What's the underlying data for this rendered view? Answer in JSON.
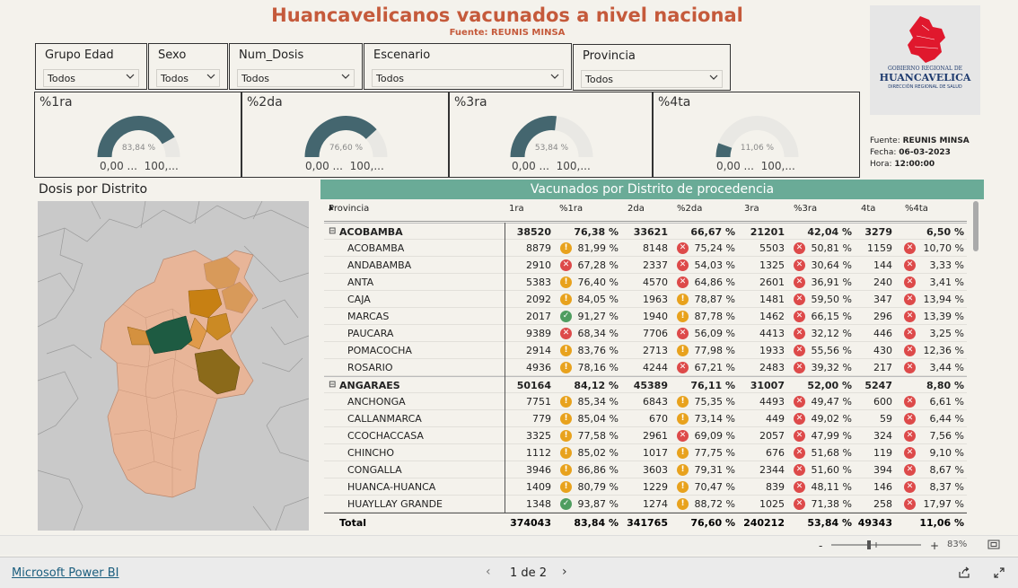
{
  "header": {
    "title": "Huancavelicanos vacunados a nivel nacional",
    "subtitle": "Fuente: REUNIS MINSA"
  },
  "logo": {
    "line1": "GOBIERNO REGIONAL DE",
    "line2": "HUANCAVELICA",
    "line3": "DIRECCIÓN REGIONAL DE SALUD"
  },
  "meta": {
    "fuente_label": "Fuente:",
    "fuente": "REUNIS MINSA",
    "fecha_label": "Fecha:",
    "fecha": "06-03-2023",
    "hora_label": "Hora:",
    "hora": "12:00:00"
  },
  "slicers": [
    {
      "label": "Grupo Edad",
      "value": "Todos"
    },
    {
      "label": "Sexo",
      "value": "Todos"
    },
    {
      "label": "Num_Dosis",
      "value": "Todos"
    },
    {
      "label": "Escenario",
      "value": "Todos"
    },
    {
      "label": "Provincia",
      "value": "Todos"
    }
  ],
  "kpis": [
    {
      "label": "%1ra",
      "value_text": "83,84 %",
      "fraction": 0.8384,
      "min": "0,00 ...",
      "max": "100,..."
    },
    {
      "label": "%2da",
      "value_text": "76,60 %",
      "fraction": 0.766,
      "min": "0,00 ...",
      "max": "100,..."
    },
    {
      "label": "%3ra",
      "value_text": "53,84 %",
      "fraction": 0.5384,
      "min": "0,00 ...",
      "max": "100,..."
    },
    {
      "label": "%4ta",
      "value_text": "11,06 %",
      "fraction": 0.1106,
      "min": "0,00 ...",
      "max": "100,..."
    }
  ],
  "map": {
    "title": "Dosis por Distrito"
  },
  "table": {
    "title": "Vacunados por Distrito de procedencia",
    "columns": [
      "Provincia",
      "1ra",
      "%1ra",
      "2da",
      "%2da",
      "3ra",
      "%3ra",
      "4ta",
      "%4ta"
    ],
    "rows": [
      {
        "type": "prov",
        "name": "ACOBAMBA",
        "d1": "38520",
        "p1": "76,38 %",
        "d2": "33621",
        "p2": "66,67 %",
        "d3": "21201",
        "p3": "42,04 %",
        "d4": "3279",
        "p4": "6,50 %"
      },
      {
        "type": "dist",
        "name": "ACOBAMBA",
        "d1": "8879",
        "p1": "81,99 %",
        "i1": "yel",
        "d2": "8148",
        "p2": "75,24 %",
        "i2": "red",
        "d3": "5503",
        "p3": "50,81 %",
        "i3": "red",
        "d4": "1159",
        "p4": "10,70 %",
        "i4": "red"
      },
      {
        "type": "dist",
        "name": "ANDABAMBA",
        "d1": "2910",
        "p1": "67,28 %",
        "i1": "red",
        "d2": "2337",
        "p2": "54,03 %",
        "i2": "red",
        "d3": "1325",
        "p3": "30,64 %",
        "i3": "red",
        "d4": "144",
        "p4": "3,33 %",
        "i4": "red"
      },
      {
        "type": "dist",
        "name": "ANTA",
        "d1": "5383",
        "p1": "76,40 %",
        "i1": "yel",
        "d2": "4570",
        "p2": "64,86 %",
        "i2": "red",
        "d3": "2601",
        "p3": "36,91 %",
        "i3": "red",
        "d4": "240",
        "p4": "3,41 %",
        "i4": "red"
      },
      {
        "type": "dist",
        "name": "CAJA",
        "d1": "2092",
        "p1": "84,05 %",
        "i1": "yel",
        "d2": "1963",
        "p2": "78,87 %",
        "i2": "yel",
        "d3": "1481",
        "p3": "59,50 %",
        "i3": "red",
        "d4": "347",
        "p4": "13,94 %",
        "i4": "red"
      },
      {
        "type": "dist",
        "name": "MARCAS",
        "d1": "2017",
        "p1": "91,27 %",
        "i1": "grn",
        "d2": "1940",
        "p2": "87,78 %",
        "i2": "yel",
        "d3": "1462",
        "p3": "66,15 %",
        "i3": "red",
        "d4": "296",
        "p4": "13,39 %",
        "i4": "red"
      },
      {
        "type": "dist",
        "name": "PAUCARA",
        "d1": "9389",
        "p1": "68,34 %",
        "i1": "red",
        "d2": "7706",
        "p2": "56,09 %",
        "i2": "red",
        "d3": "4413",
        "p3": "32,12 %",
        "i3": "red",
        "d4": "446",
        "p4": "3,25 %",
        "i4": "red"
      },
      {
        "type": "dist",
        "name": "POMACOCHA",
        "d1": "2914",
        "p1": "83,76 %",
        "i1": "yel",
        "d2": "2713",
        "p2": "77,98 %",
        "i2": "yel",
        "d3": "1933",
        "p3": "55,56 %",
        "i3": "red",
        "d4": "430",
        "p4": "12,36 %",
        "i4": "red"
      },
      {
        "type": "dist",
        "name": "ROSARIO",
        "d1": "4936",
        "p1": "78,16 %",
        "i1": "yel",
        "d2": "4244",
        "p2": "67,21 %",
        "i2": "red",
        "d3": "2483",
        "p3": "39,32 %",
        "i3": "red",
        "d4": "217",
        "p4": "3,44 %",
        "i4": "red"
      },
      {
        "type": "prov",
        "name": "ANGARAES",
        "d1": "50164",
        "p1": "84,12 %",
        "d2": "45389",
        "p2": "76,11 %",
        "d3": "31007",
        "p3": "52,00 %",
        "d4": "5247",
        "p4": "8,80 %"
      },
      {
        "type": "dist",
        "name": "ANCHONGA",
        "d1": "7751",
        "p1": "85,34 %",
        "i1": "yel",
        "d2": "6843",
        "p2": "75,35 %",
        "i2": "yel",
        "d3": "4493",
        "p3": "49,47 %",
        "i3": "red",
        "d4": "600",
        "p4": "6,61 %",
        "i4": "red"
      },
      {
        "type": "dist",
        "name": "CALLANMARCA",
        "d1": "779",
        "p1": "85,04 %",
        "i1": "yel",
        "d2": "670",
        "p2": "73,14 %",
        "i2": "yel",
        "d3": "449",
        "p3": "49,02 %",
        "i3": "red",
        "d4": "59",
        "p4": "6,44 %",
        "i4": "red"
      },
      {
        "type": "dist",
        "name": "CCOCHACCASA",
        "d1": "3325",
        "p1": "77,58 %",
        "i1": "yel",
        "d2": "2961",
        "p2": "69,09 %",
        "i2": "red",
        "d3": "2057",
        "p3": "47,99 %",
        "i3": "red",
        "d4": "324",
        "p4": "7,56 %",
        "i4": "red"
      },
      {
        "type": "dist",
        "name": "CHINCHO",
        "d1": "1112",
        "p1": "85,02 %",
        "i1": "yel",
        "d2": "1017",
        "p2": "77,75 %",
        "i2": "yel",
        "d3": "676",
        "p3": "51,68 %",
        "i3": "red",
        "d4": "119",
        "p4": "9,10 %",
        "i4": "red"
      },
      {
        "type": "dist",
        "name": "CONGALLA",
        "d1": "3946",
        "p1": "86,86 %",
        "i1": "yel",
        "d2": "3603",
        "p2": "79,31 %",
        "i2": "yel",
        "d3": "2344",
        "p3": "51,60 %",
        "i3": "red",
        "d4": "394",
        "p4": "8,67 %",
        "i4": "red"
      },
      {
        "type": "dist",
        "name": "HUANCA-HUANCA",
        "d1": "1409",
        "p1": "80,79 %",
        "i1": "yel",
        "d2": "1229",
        "p2": "70,47 %",
        "i2": "yel",
        "d3": "839",
        "p3": "48,11 %",
        "i3": "red",
        "d4": "146",
        "p4": "8,37 %",
        "i4": "red"
      },
      {
        "type": "dist",
        "name": "HUAYLLAY GRANDE",
        "d1": "1348",
        "p1": "93,87 %",
        "i1": "grn",
        "d2": "1274",
        "p2": "88,72 %",
        "i2": "yel",
        "d3": "1025",
        "p3": "71,38 %",
        "i3": "red",
        "d4": "258",
        "p4": "17,97 %",
        "i4": "red"
      }
    ],
    "total": {
      "name": "Total",
      "d1": "374043",
      "p1": "83,84 %",
      "d2": "341765",
      "p2": "76,60 %",
      "d3": "240212",
      "p3": "53,84 %",
      "d4": "49343",
      "p4": "11,06 %"
    }
  },
  "zoom": {
    "minus": "-",
    "plus": "+",
    "percent": "83%"
  },
  "footer": {
    "brand": "Microsoft Power BI",
    "page": "1 de 2"
  },
  "colors": {
    "accent": "#c55a3b",
    "gauge": "#44666f",
    "header_bar": "#6aab97",
    "red": "#dd4a4a",
    "yellow": "#e8a21d",
    "green": "#4f9d60"
  }
}
